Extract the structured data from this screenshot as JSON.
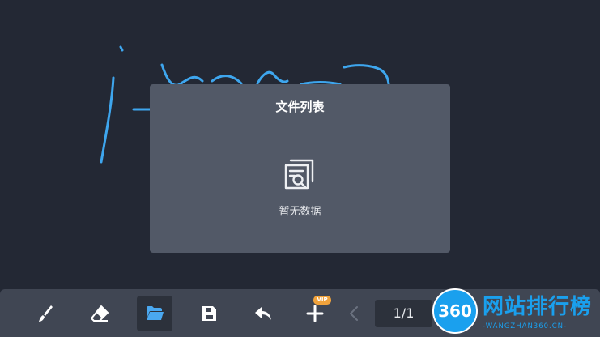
{
  "modal": {
    "title": "文件列表",
    "empty_text": "暂无数据"
  },
  "toolbar": {
    "tools": [
      {
        "name": "brush",
        "icon": "brush-icon"
      },
      {
        "name": "eraser",
        "icon": "eraser-icon"
      },
      {
        "name": "open-file",
        "icon": "folder-open-icon",
        "active": true
      },
      {
        "name": "save",
        "icon": "save-icon"
      },
      {
        "name": "undo",
        "icon": "undo-icon"
      },
      {
        "name": "add-page",
        "icon": "plus-icon",
        "badge": "VIP"
      },
      {
        "name": "prev-page",
        "icon": "chevron-left-icon"
      }
    ],
    "page_indicator": "1/1"
  },
  "watermark": {
    "logo_text": "360",
    "title": "网站排行榜",
    "subtitle": "-WANGZHAN360.CN-"
  },
  "colors": {
    "background": "#232834",
    "modal": "#525967",
    "toolbar": "#404653",
    "ink": "#3ea6ee",
    "vip": "#f1a33c",
    "watermark": "#1aa0ee"
  }
}
